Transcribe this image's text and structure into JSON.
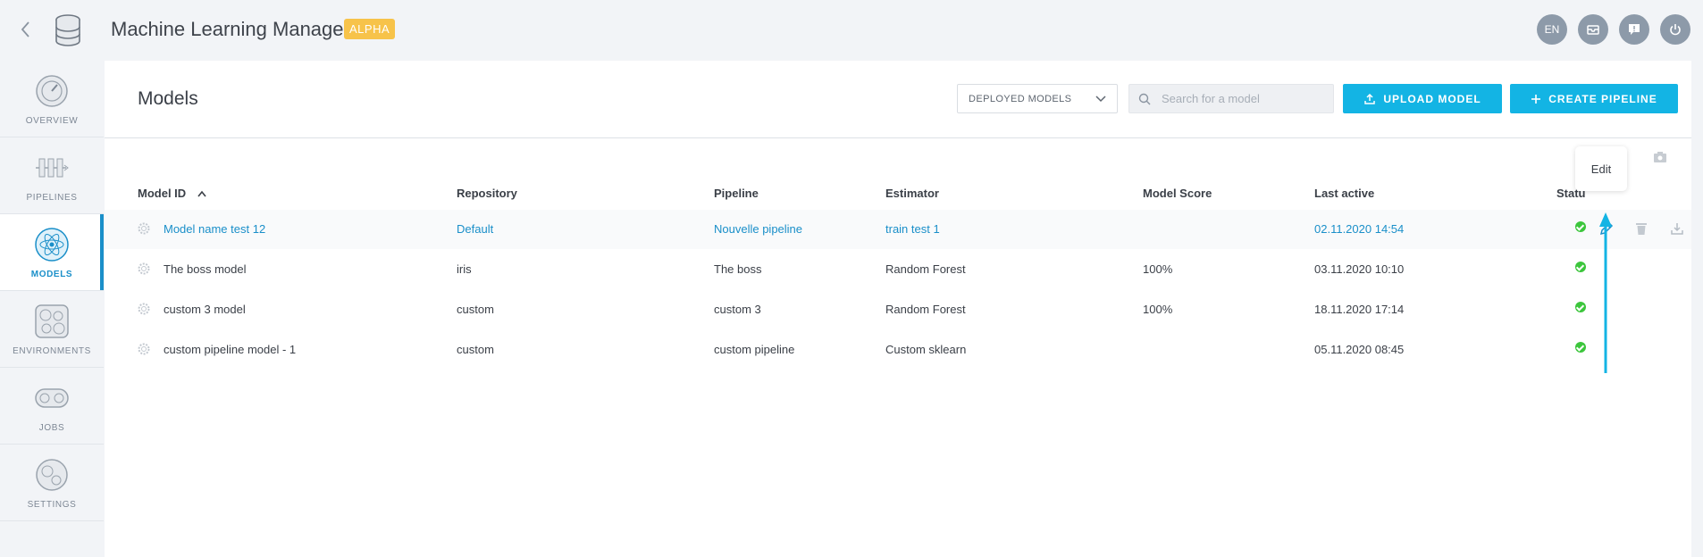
{
  "app": {
    "title": "Machine Learning Manager",
    "badge": "ALPHA"
  },
  "topbar": {
    "language": "EN"
  },
  "sidebar": {
    "items": [
      {
        "label": "OVERVIEW"
      },
      {
        "label": "PIPELINES"
      },
      {
        "label": "MODELS"
      },
      {
        "label": "ENVIRONMENTS"
      },
      {
        "label": "JOBS"
      },
      {
        "label": "SETTINGS"
      }
    ]
  },
  "main": {
    "title": "Models",
    "filter": {
      "selected": "DEPLOYED MODELS"
    },
    "search": {
      "placeholder": "Search for a model"
    },
    "upload_label": "UPLOAD MODEL",
    "create_label": "CREATE PIPELINE"
  },
  "table": {
    "headers": [
      "Model ID",
      "Repository",
      "Pipeline",
      "Estimator",
      "Model Score",
      "Last active",
      "Statu"
    ],
    "rows": [
      {
        "id": "Model name test 12",
        "repository": "Default",
        "pipeline": "Nouvelle pipeline",
        "estimator": "train test 1",
        "score": "",
        "last_active": "02.11.2020 14:54"
      },
      {
        "id": "The boss model",
        "repository": "iris",
        "pipeline": "The boss",
        "estimator": "Random Forest",
        "score": "100%",
        "last_active": "03.11.2020 10:10"
      },
      {
        "id": "custom 3 model",
        "repository": "custom",
        "pipeline": "custom 3",
        "estimator": "Random Forest",
        "score": "100%",
        "last_active": "18.11.2020 17:14"
      },
      {
        "id": "custom pipeline model - 1",
        "repository": "custom",
        "pipeline": "custom pipeline",
        "estimator": "Custom sklearn",
        "score": "",
        "last_active": "05.11.2020 08:45"
      }
    ]
  },
  "tooltip": {
    "text": "Edit"
  },
  "colors": {
    "accent": "#13b4e4",
    "link": "#1a8fc9",
    "badge": "#f7c34a",
    "status_ok": "#3cc63c"
  }
}
